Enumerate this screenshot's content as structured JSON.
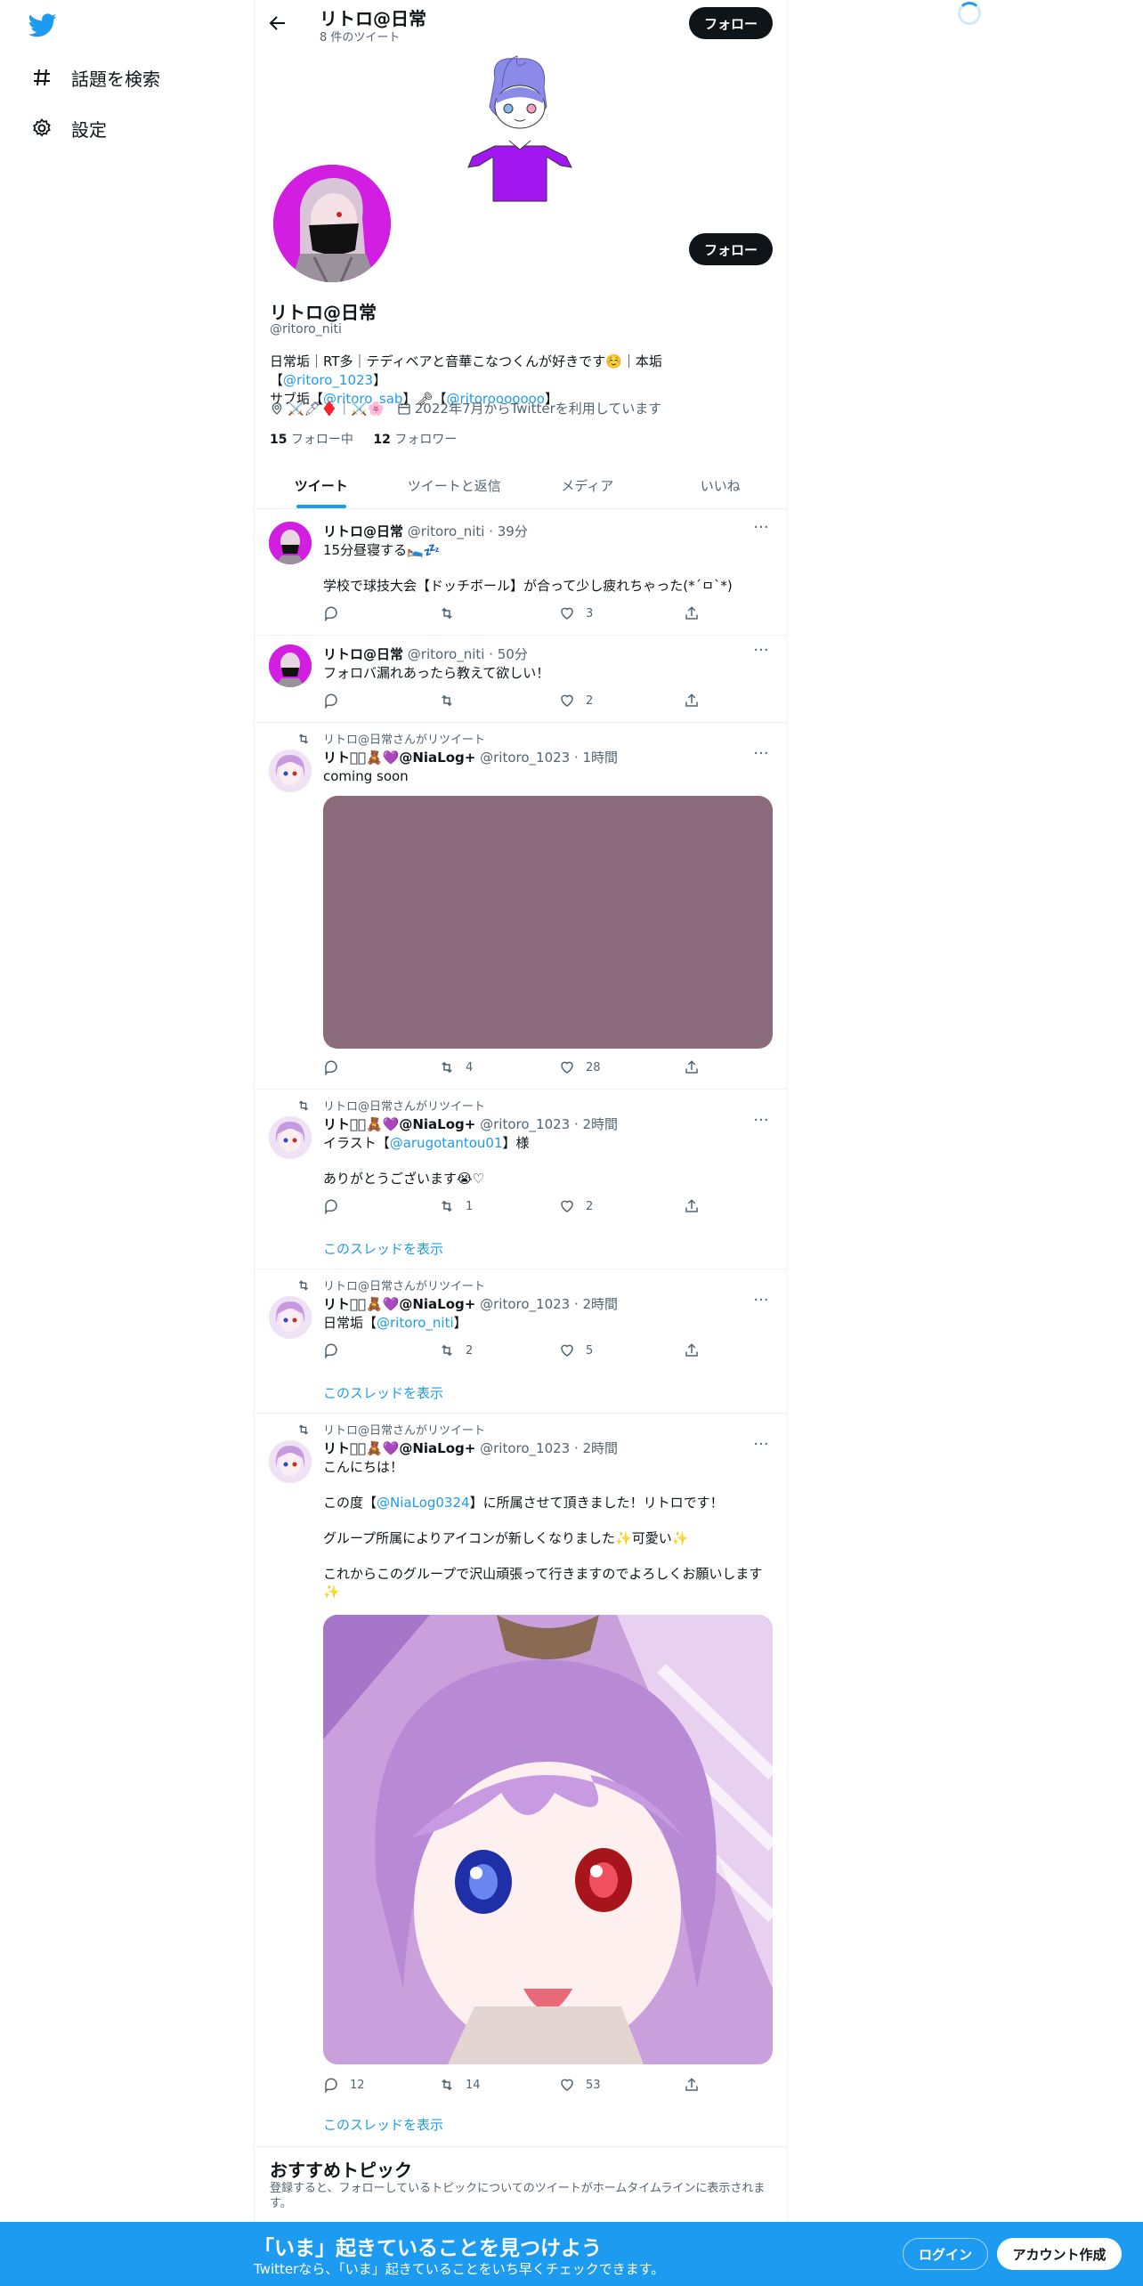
{
  "nav": {
    "explore_label": "話題を検索",
    "settings_label": "設定"
  },
  "topbar": {
    "title": "リトロ@日常",
    "tweet_count": "8 件のツイート",
    "follow_label": "フォロー"
  },
  "profile": {
    "name": "リトロ@日常",
    "handle": "@ritoro_niti",
    "follow_label": "フォロー",
    "bio_line1_a": "日常垢｜RT多｜テディベアと音華こなつくんが好きです☺️｜本垢【",
    "bio_link1": "@ritoro_1023",
    "bio_line1_b": "】",
    "bio_line2_a": "サブ垢【",
    "bio_link2": "@ritoro_sab",
    "bio_line2_b": "】🗝【",
    "bio_link3": "@ritorooooooo",
    "bio_line2_c": "】",
    "location": "⚔️🖊♦️｜⚔️🌸",
    "joined": "2022年7月からTwitterを利用しています",
    "following_count": "15",
    "following_label": "フォロー中",
    "followers_count": "12",
    "followers_label": "フォロワー"
  },
  "tabs": [
    "ツイート",
    "ツイートと返信",
    "メディア",
    "いいね"
  ],
  "tweets": [
    {
      "name": "リトロ@日常",
      "meta": "@ritoro_niti · 39分",
      "text": "15分昼寝する🛌💤\n\n学校で球技大会【ドッチボール】が合って少し疲れちゃった(*´ㅁ`*)",
      "reply": "",
      "retweet": "",
      "like": "3"
    },
    {
      "name": "リトロ@日常",
      "meta": "@ritoro_niti · 50分",
      "text": "フォロバ漏れあったら教えて欲しい！",
      "reply": "",
      "retweet": "",
      "like": "2"
    },
    {
      "rt_label": "リトロ@日常さんがリツイート",
      "name": "リトロ🏻🧸💜@NiaLog+",
      "meta": "@ritoro_1023 · 1時間",
      "text": "coming soon",
      "media_color": "#8b6a7b",
      "reply": "",
      "retweet": "4",
      "like": "28"
    },
    {
      "rt_label": "リトロ@日常さんがリツイート",
      "name": "リトロ🏻🧸💜@NiaLog+",
      "meta": "@ritoro_1023 · 2時間",
      "text_a": "イラスト【",
      "text_link": "@arugotantou01",
      "text_b": "】様\n\nありがとうございます😭♡",
      "reply": "",
      "retweet": "1",
      "like": "2",
      "thread": "このスレッドを表示"
    },
    {
      "rt_label": "リトロ@日常さんがリツイート",
      "name": "リトロ🏻🧸💜@NiaLog+",
      "meta": "@ritoro_1023 · 2時間",
      "text_a": "日常垢【",
      "text_link": "@ritoro_niti",
      "text_b": "】",
      "reply": "",
      "retweet": "2",
      "like": "5",
      "thread": "このスレッドを表示"
    },
    {
      "rt_label": "リトロ@日常さんがリツイート",
      "name": "リトロ🏻🧸💜@NiaLog+",
      "meta": "@ritoro_1023 · 2時間",
      "text_a": "こんにちは！\n\nこの度【",
      "text_link": "@NiaLog0324",
      "text_b": "】に所属させて頂きました！リトロです！\n\nグループ所属によりアイコンが新しくなりました✨可愛い✨\n\nこれからこのグループで沢山頑張って行きますのでよろしくお願いします✨",
      "reply": "12",
      "retweet": "14",
      "like": "53",
      "thread": "このスレッドを表示"
    }
  ],
  "recommended": {
    "title": "おすすめトピック",
    "sub": "登録すると、フォローしているトピックについてのツイートがホームタイムラインに表示されます。"
  },
  "bottom": {
    "title": "「いま」起きていることを見つけよう",
    "sub": "Twitterなら、「いま」起きていることをいち早くチェックできます。",
    "login": "ログイン",
    "signup": "アカウント作成"
  }
}
